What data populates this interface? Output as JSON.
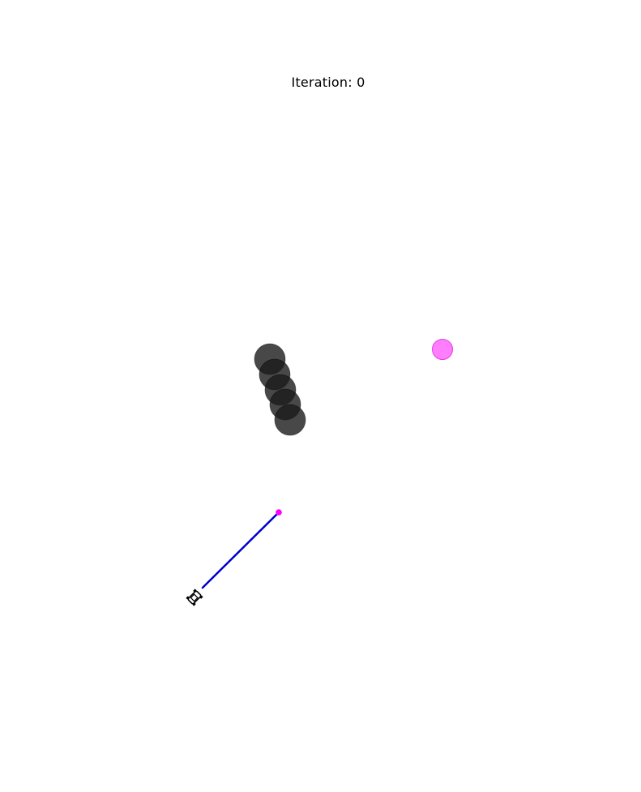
{
  "title": "Iteration: 0",
  "colors": {
    "obstacle": "#1a1a1a",
    "goal": "#ff66ff",
    "goal_edge": "#e040e0",
    "path": "#0000cc",
    "waypoint": "#ff00ff",
    "agent": "#000000"
  },
  "icons": {
    "agent": "car-icon"
  }
}
